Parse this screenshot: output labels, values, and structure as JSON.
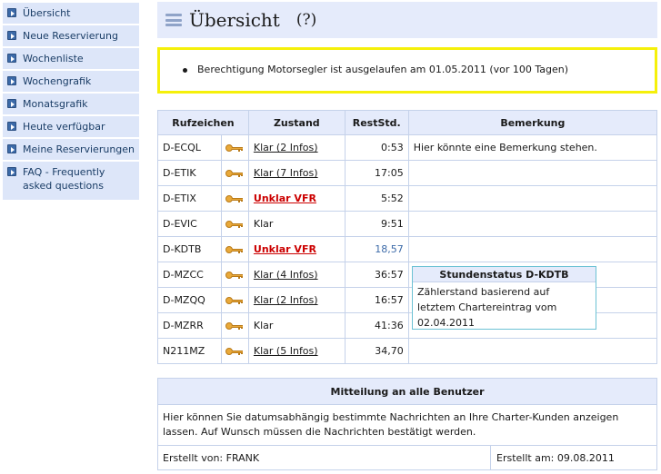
{
  "sidebar": {
    "items": [
      {
        "label": "Übersicht"
      },
      {
        "label": "Neue Reservierung"
      },
      {
        "label": "Wochenliste"
      },
      {
        "label": "Wochengrafik"
      },
      {
        "label": "Monatsgrafik"
      },
      {
        "label": "Heute verfügbar"
      },
      {
        "label": "Meine Reservierungen"
      },
      {
        "label_line1": "FAQ - Frequently",
        "label_line2": "asked questions"
      }
    ]
  },
  "header": {
    "title": "Übersicht",
    "help": "(?)",
    "icon": "menu-icon"
  },
  "notice": {
    "text": "Berechtigung Motorsegler ist ausgelaufen am 01.05.2011 (vor 100 Tagen)",
    "border_color": "#f5f00a"
  },
  "table": {
    "headers": {
      "callsign": "Rufzeichen",
      "status": "Zustand",
      "hours": "RestStd.",
      "remark": "Bemerkung"
    },
    "rows": [
      {
        "callsign": "D-ECQL",
        "status": "Klar (2 Infos)",
        "hours": "0:53",
        "remark": "Hier könnte eine Bemerkung stehen."
      },
      {
        "callsign": "D-ETIK",
        "status": "Klar (7 Infos)",
        "hours": "17:05",
        "remark": ""
      },
      {
        "callsign": "D-ETIX",
        "status": "Unklar VFR",
        "hours": "5:52",
        "remark": ""
      },
      {
        "callsign": "D-EVIC",
        "status": "Klar",
        "hours": "9:51",
        "remark": ""
      },
      {
        "callsign": "D-KDTB",
        "status": "Unklar VFR",
        "hours": "18,57",
        "remark": ""
      },
      {
        "callsign": "D-MZCC",
        "status": "Klar (4 Infos)",
        "hours": "36:57",
        "remark": ""
      },
      {
        "callsign": "D-MZQQ",
        "status": "Klar (2 Infos)",
        "hours": "16:57",
        "remark": ""
      },
      {
        "callsign": "D-MZRR",
        "status": "Klar",
        "hours": "41:36",
        "remark": ""
      },
      {
        "callsign": "N211MZ",
        "status": "Klar (5 Infos)",
        "hours": "34,70",
        "remark": ""
      }
    ]
  },
  "tooltip": {
    "title": "Stundenstatus D-KDTB",
    "line1": "Zählerstand basierend auf",
    "line2": "letztem Chartereintrag vom",
    "line3": "02.04.2011"
  },
  "message": {
    "title": "Mitteilung an alle Benutzer",
    "line1": "Hier können Sie datumsabhängig bestimmte Nachrichten an Ihre Charter-Kunden anzeigen",
    "line2": "lassen. Auf Wunsch müssen die Nachrichten bestätigt werden.",
    "created_by": "Erstellt von: FRANK",
    "created_on": "Erstellt am: 09.08.2011"
  },
  "colors": {
    "accent": "#e5ebfb",
    "warning": "#cc0000",
    "link_blue": "#3c6aa8"
  }
}
